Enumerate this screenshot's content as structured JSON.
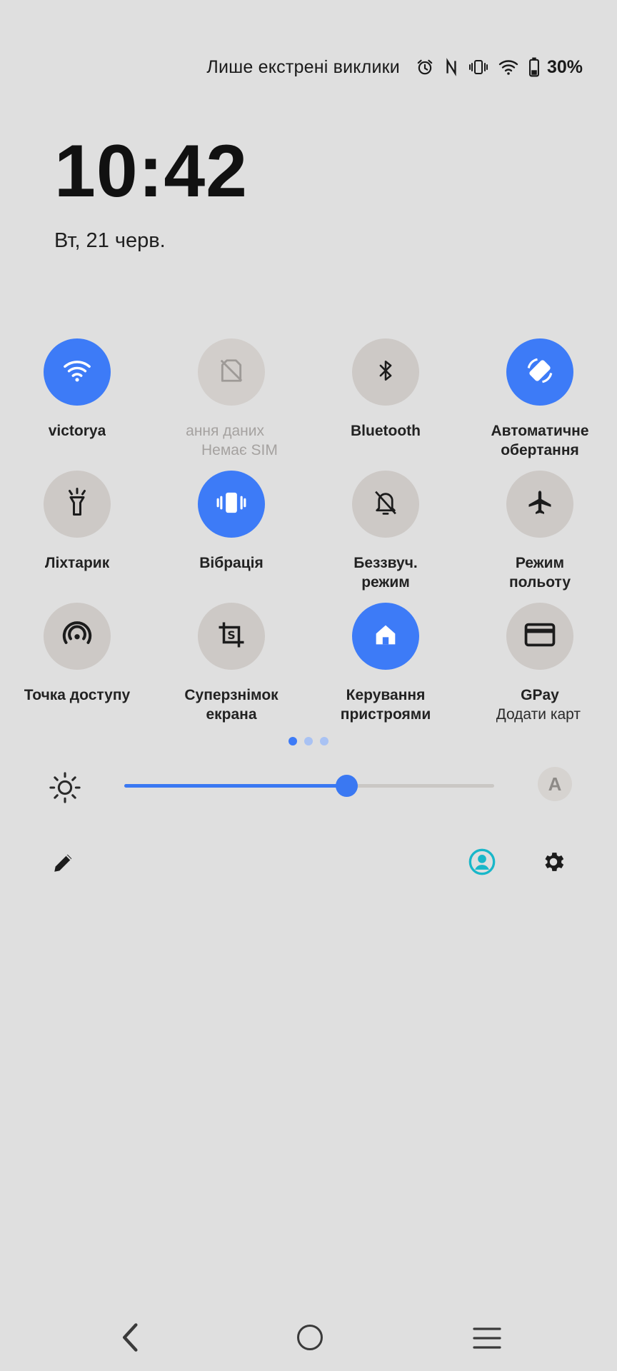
{
  "status_bar": {
    "text": "Лише екстрені виклики",
    "battery": "30%",
    "icons": [
      "alarm-icon",
      "nfc-icon",
      "vibrate-icon",
      "wifi-icon",
      "battery-icon"
    ]
  },
  "clock": {
    "time": "10:42",
    "date": "Вт, 21 черв."
  },
  "tiles": [
    {
      "label": "victorya",
      "sub": "",
      "icon": "wifi-icon",
      "state": "on"
    },
    {
      "label": "ання даних",
      "sub": "Немає SIM",
      "icon": "no-sim-icon",
      "state": "disabled"
    },
    {
      "label": "Bluetooth",
      "sub": "",
      "icon": "bluetooth-icon",
      "state": "off"
    },
    {
      "label": "Автоматичне",
      "sub": "обертання",
      "icon": "auto-rotate-icon",
      "state": "on"
    },
    {
      "label": "Ліхтарик",
      "sub": "",
      "icon": "flashlight-icon",
      "state": "off"
    },
    {
      "label": "Вібрація",
      "sub": "",
      "icon": "vibrate-icon",
      "state": "on"
    },
    {
      "label": "Беззвуч.",
      "sub": "режим",
      "icon": "silent-bell-icon",
      "state": "off"
    },
    {
      "label": "Режим",
      "sub": "польоту",
      "icon": "airplane-icon",
      "state": "off"
    },
    {
      "label": "Точка доступу",
      "sub": "",
      "icon": "hotspot-icon",
      "state": "off"
    },
    {
      "label": "Суперзнімок",
      "sub": "екрана",
      "icon": "screenshot-crop-icon",
      "state": "off"
    },
    {
      "label": "Керування",
      "sub": "пристроями",
      "icon": "home-icon",
      "state": "on"
    },
    {
      "label": "GPay",
      "sub": "Додати карт",
      "icon": "card-icon",
      "state": "off"
    }
  ],
  "pagination": {
    "pages": 3,
    "current": 1
  },
  "brightness": {
    "level": 0.6,
    "auto_label": "A"
  },
  "colors": {
    "accent": "#3d7bf7",
    "tile_off": "#cdc9c6",
    "background": "#dfdfdf",
    "user_icon": "#19b7c9"
  },
  "nav_bar": [
    "back-icon",
    "home-circle-icon",
    "recents-icon"
  ]
}
